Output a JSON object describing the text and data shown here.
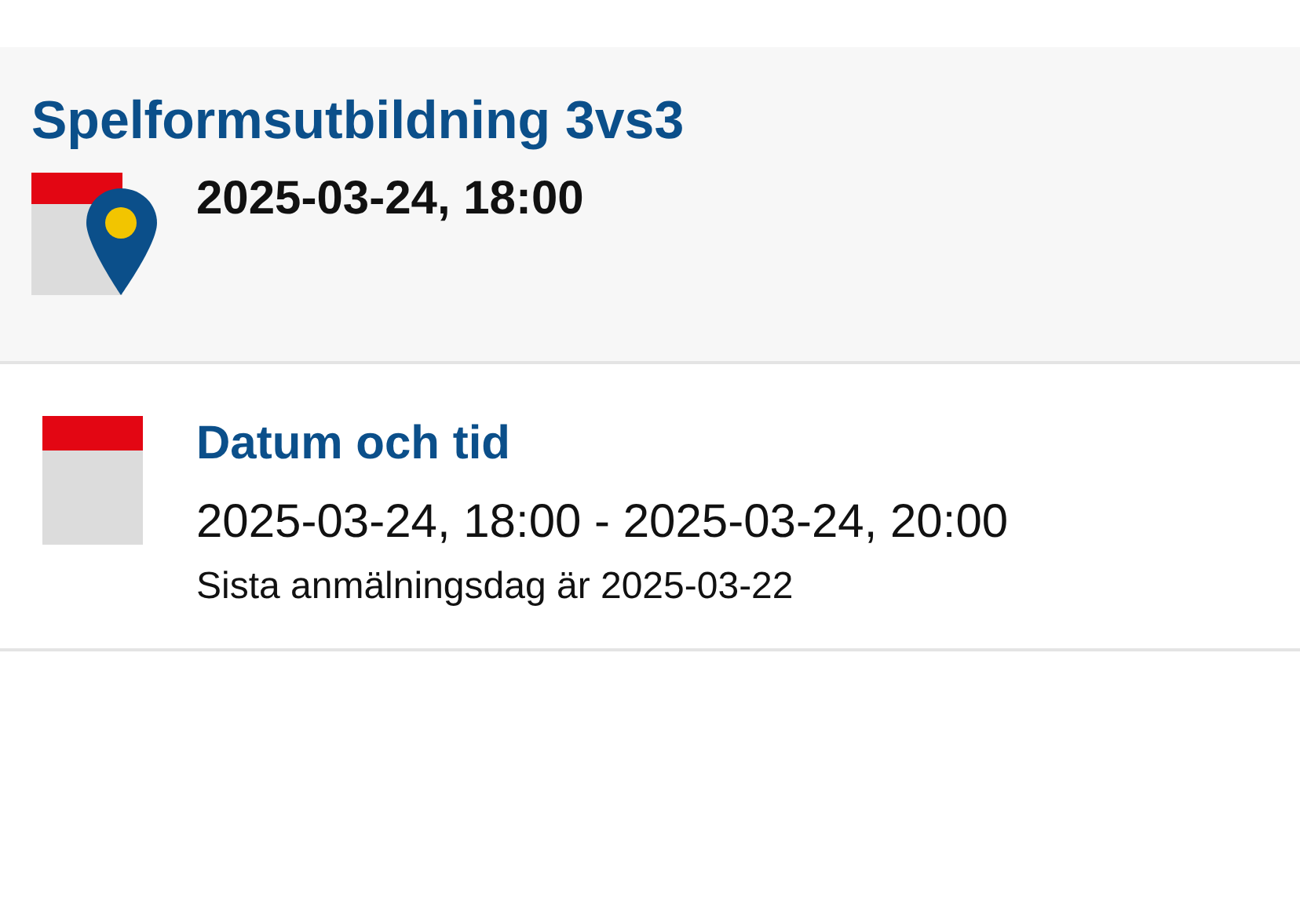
{
  "event": {
    "title": "Spelformsutbildning 3vs3",
    "date": "2025-03-24, 18:00"
  },
  "details": [
    {
      "heading": "Datum och tid",
      "value": "2025-03-24, 18:00 - 2025-03-24, 20:00",
      "note": "Sista anmälningsdag är 2025-03-22"
    }
  ]
}
